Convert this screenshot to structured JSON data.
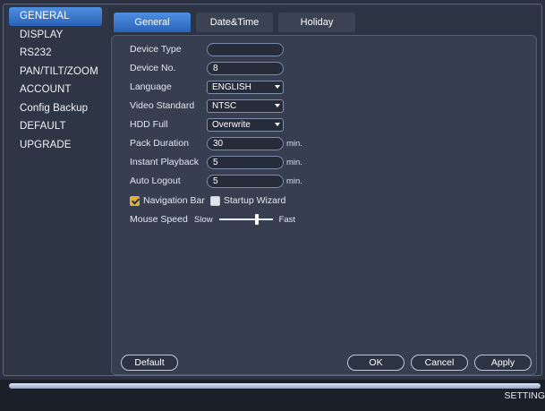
{
  "sidebar": {
    "items": [
      {
        "label": "GENERAL",
        "active": true
      },
      {
        "label": "DISPLAY",
        "active": false
      },
      {
        "label": "RS232",
        "active": false
      },
      {
        "label": "PAN/TILT/ZOOM",
        "active": false
      },
      {
        "label": "ACCOUNT",
        "active": false
      },
      {
        "label": "Config Backup",
        "active": false
      },
      {
        "label": "DEFAULT",
        "active": false
      },
      {
        "label": "UPGRADE",
        "active": false
      }
    ]
  },
  "tabs": [
    {
      "label": "General",
      "active": true
    },
    {
      "label": "Date&Time",
      "active": false
    },
    {
      "label": "Holiday",
      "active": false
    }
  ],
  "form": {
    "device_type": {
      "label": "Device Type",
      "value": ""
    },
    "device_no": {
      "label": "Device No.",
      "value": "8"
    },
    "language": {
      "label": "Language",
      "value": "ENGLISH"
    },
    "video_standard": {
      "label": "Video Standard",
      "value": "NTSC"
    },
    "hdd_full": {
      "label": "HDD Full",
      "value": "Overwrite"
    },
    "pack_duration": {
      "label": "Pack Duration",
      "value": "30",
      "unit": "min."
    },
    "instant_playback": {
      "label": "Instant Playback",
      "value": "5",
      "unit": "min."
    },
    "auto_logout": {
      "label": "Auto Logout",
      "value": "5",
      "unit": "min."
    },
    "navigation_bar": {
      "label": "Navigation Bar",
      "checked": true
    },
    "startup_wizard": {
      "label": "Startup Wizard",
      "checked": false
    },
    "mouse_speed": {
      "label": "Mouse Speed",
      "min_label": "Slow",
      "max_label": "Fast",
      "level": 0.7
    }
  },
  "buttons": {
    "default": "Default",
    "ok": "OK",
    "cancel": "Cancel",
    "apply": "Apply"
  },
  "footer": {
    "label": "SETTING"
  },
  "colors": {
    "accent": "#3b7bd6",
    "checkbox_on": "#e2b03a"
  }
}
